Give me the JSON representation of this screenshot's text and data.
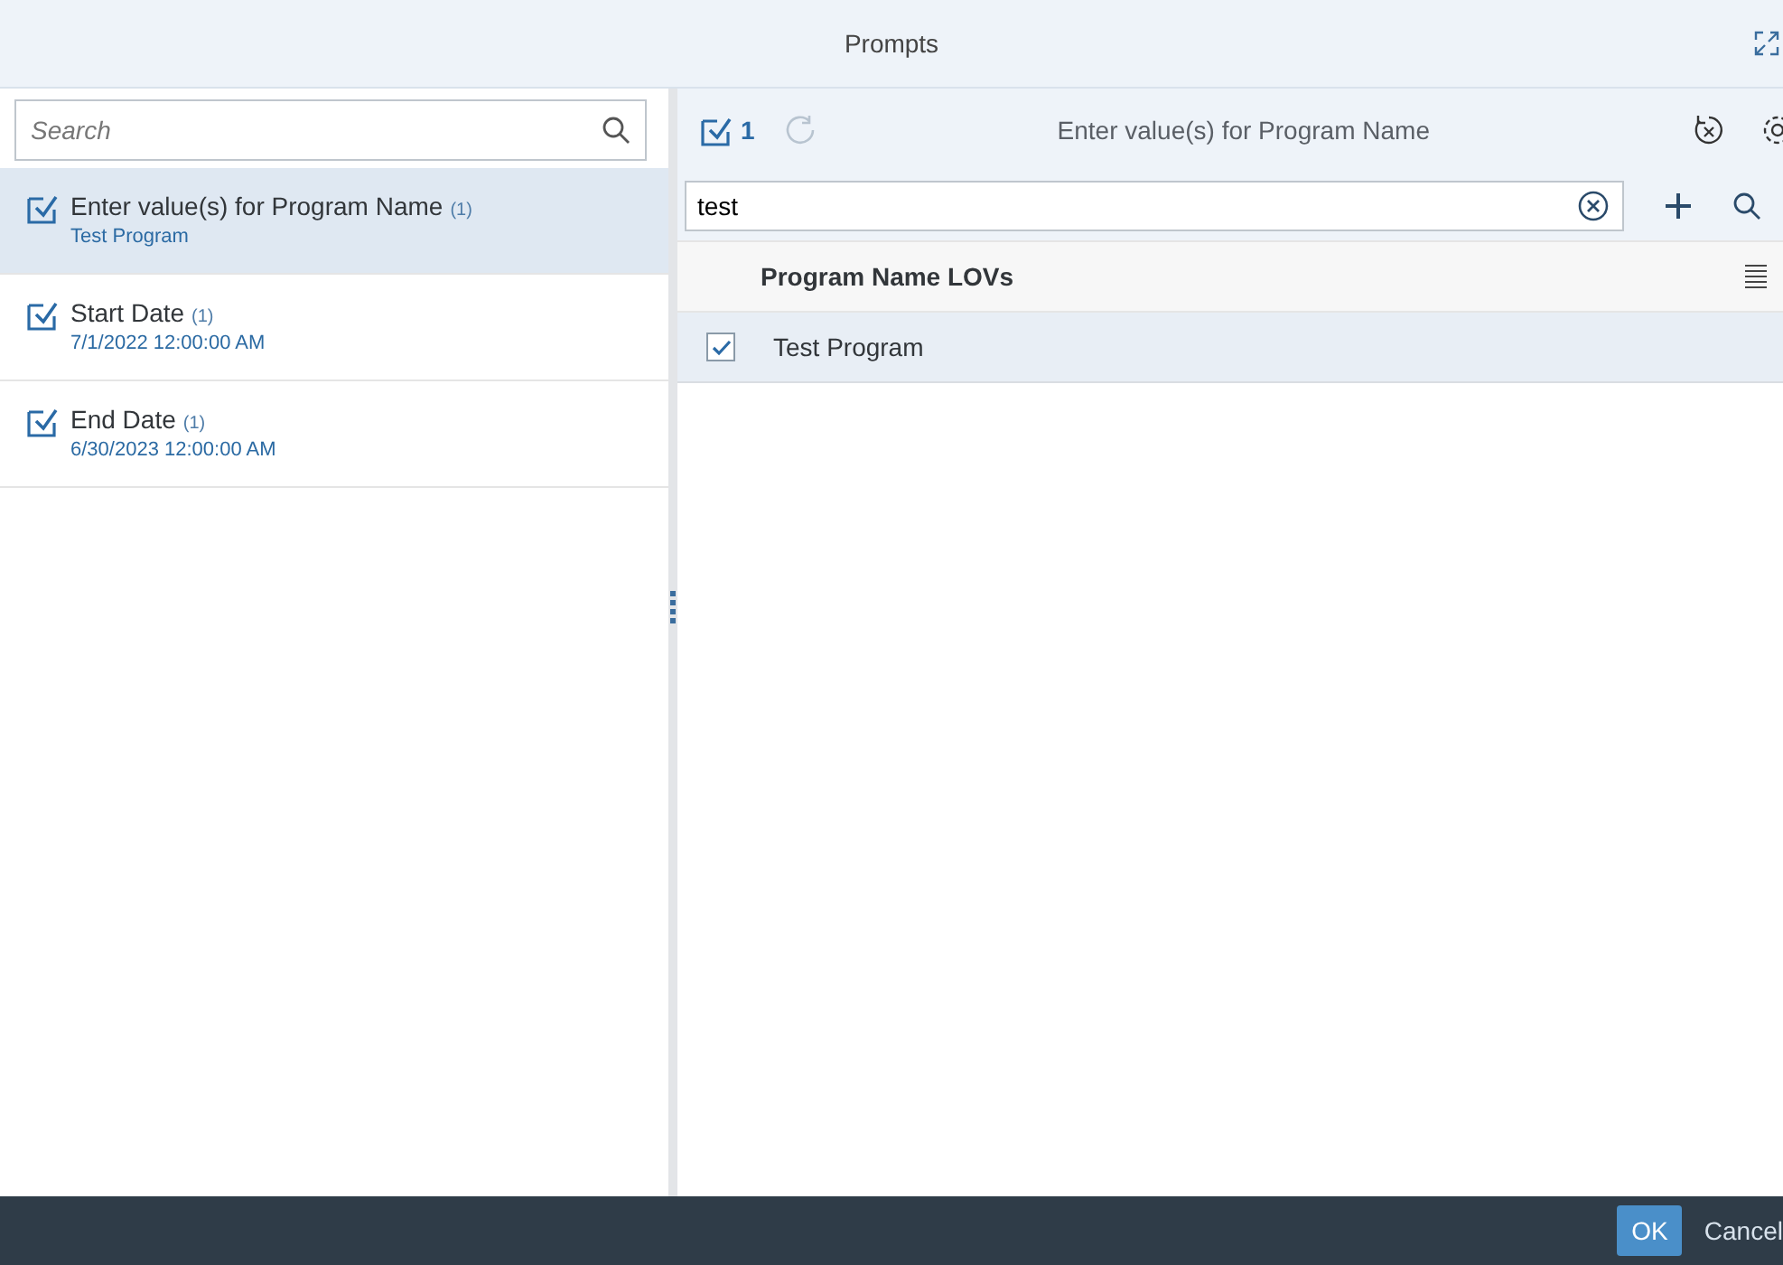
{
  "window": {
    "title": "Prompts"
  },
  "sidebar": {
    "search": {
      "placeholder": "Search"
    },
    "items": [
      {
        "title": "Enter value(s) for Program Name",
        "count": "(1)",
        "value": "Test Program",
        "selected": true,
        "checked": true
      },
      {
        "title": "Start Date",
        "count": "(1)",
        "value": "7/1/2022 12:00:00 AM",
        "selected": false,
        "checked": true
      },
      {
        "title": "End Date",
        "count": "(1)",
        "value": "6/30/2023 12:00:00 AM",
        "selected": false,
        "checked": true
      }
    ]
  },
  "detail": {
    "selected_count": "1",
    "title": "Enter value(s) for Program Name",
    "search": {
      "value": "test"
    },
    "table": {
      "columns": [
        "Program Name LOVs"
      ],
      "rows": [
        {
          "cells": [
            "Test Program"
          ],
          "checked": true,
          "selected": true
        }
      ]
    }
  },
  "footer": {
    "buttons": [
      {
        "label": "OK",
        "kind": "primary"
      },
      {
        "label": "Cancel",
        "kind": "plain"
      }
    ]
  }
}
